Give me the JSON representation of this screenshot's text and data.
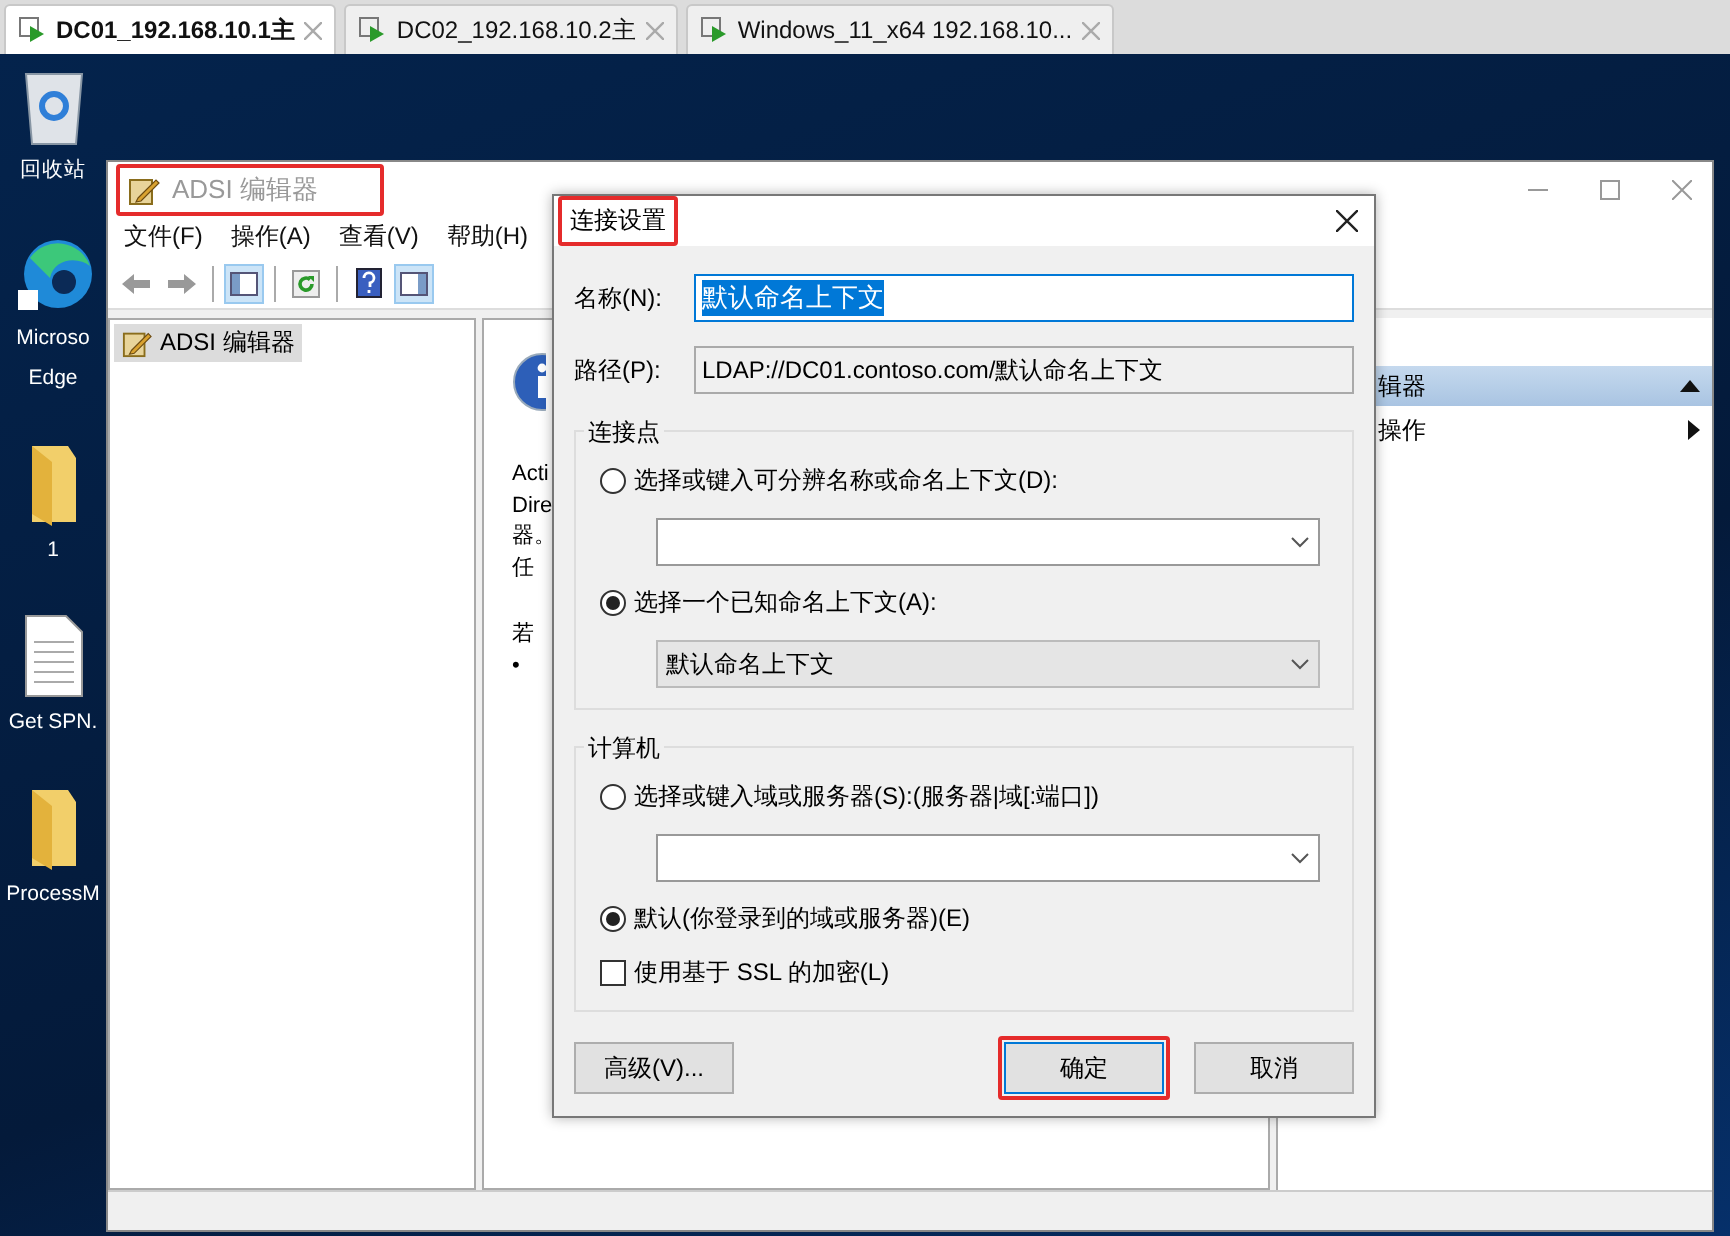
{
  "vm_tabs": [
    {
      "label": "DC01_192.168.10.1主",
      "selected": true
    },
    {
      "label": "DC02_192.168.10.2主",
      "selected": false
    },
    {
      "label": "Windows_11_x64 192.168.10...",
      "selected": false
    }
  ],
  "desktop_icons": [
    {
      "kind": "recycle",
      "lines": [
        "回收站"
      ]
    },
    {
      "kind": "edge",
      "lines": [
        "Microso",
        "Edge"
      ]
    },
    {
      "kind": "folder",
      "lines": [
        "1"
      ]
    },
    {
      "kind": "document",
      "lines": [
        "Get SPN."
      ]
    },
    {
      "kind": "folder",
      "lines": [
        "ProcessM"
      ]
    }
  ],
  "main_window": {
    "title": "ADSI 编辑器",
    "title_highlighted": true,
    "menu": [
      "文件(F)",
      "操作(A)",
      "查看(V)",
      "帮助(H)"
    ],
    "toolbar": [
      {
        "kind": "back",
        "pressed": false
      },
      {
        "kind": "forward",
        "pressed": false
      },
      {
        "kind": "tree",
        "pressed": true
      },
      {
        "kind": "refresh",
        "pressed": false
      },
      {
        "kind": "help",
        "pressed": false
      },
      {
        "kind": "actions",
        "pressed": true
      }
    ],
    "tree": [
      {
        "label": "ADSI 编辑器",
        "selected": true
      }
    ],
    "details_fragments": [
      "Acti",
      "Dire",
      "器。",
      "任",
      "若",
      "•"
    ],
    "actions_header": "辑器",
    "actions": [
      "操作"
    ]
  },
  "dialog": {
    "title": "连接设置",
    "title_highlighted": true,
    "name_label": "名称(N):",
    "name_value": "默认命名上下文",
    "path_label": "路径(P):",
    "path_value": "LDAP://DC01.contoso.com/默认命名上下文",
    "groups": [
      {
        "title": "连接点",
        "options": [
          {
            "kind": "radio",
            "label": "选择或键入可分辨名称或命名上下文(D):",
            "selected": false
          },
          {
            "kind": "combo",
            "disabled": false
          },
          {
            "kind": "radio",
            "label": "选择一个已知命名上下文(A):",
            "selected": true
          },
          {
            "kind": "combo",
            "value": "默认命名上下文",
            "disabled": true
          }
        ]
      },
      {
        "title": "计算机",
        "options": [
          {
            "kind": "radio",
            "label": "选择或键入域或服务器(S):(服务器|域[:端口])",
            "selected": false
          },
          {
            "kind": "combo",
            "disabled": false
          },
          {
            "kind": "radio",
            "label": "默认(你登录到的域或服务器)(E)",
            "selected": true
          },
          {
            "kind": "checkbox",
            "label": "使用基于 SSL 的加密(L)",
            "checked": false
          }
        ]
      }
    ],
    "buttons": [
      {
        "label": "高级(V)...",
        "default": false,
        "highlighted": false
      },
      {
        "label": "确定",
        "default": true,
        "highlighted": true
      },
      {
        "label": "取消",
        "default": false,
        "highlighted": false
      }
    ]
  }
}
